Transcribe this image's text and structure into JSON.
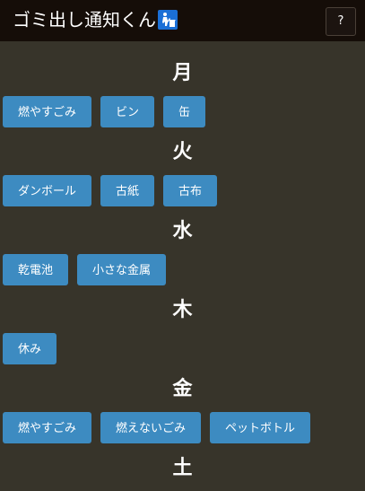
{
  "header": {
    "title": "ゴミ出し通知くん",
    "title_icon": "trash-person-icon",
    "help_label": "?"
  },
  "colors": {
    "header_bg": "#150d08",
    "page_bg": "#37342a",
    "button_bg": "#3d8bc1",
    "icon_bg": "#1b6fd6"
  },
  "days": [
    {
      "label": "月",
      "items": [
        "燃やすごみ",
        "ビン",
        "缶"
      ]
    },
    {
      "label": "火",
      "items": [
        "ダンボール",
        "古紙",
        "古布"
      ]
    },
    {
      "label": "水",
      "items": [
        "乾電池",
        "小さな金属"
      ]
    },
    {
      "label": "木",
      "items": [
        "休み"
      ]
    },
    {
      "label": "金",
      "items": [
        "燃やすごみ",
        "燃えないごみ",
        "ペットボトル"
      ]
    },
    {
      "label": "土",
      "items": []
    }
  ]
}
